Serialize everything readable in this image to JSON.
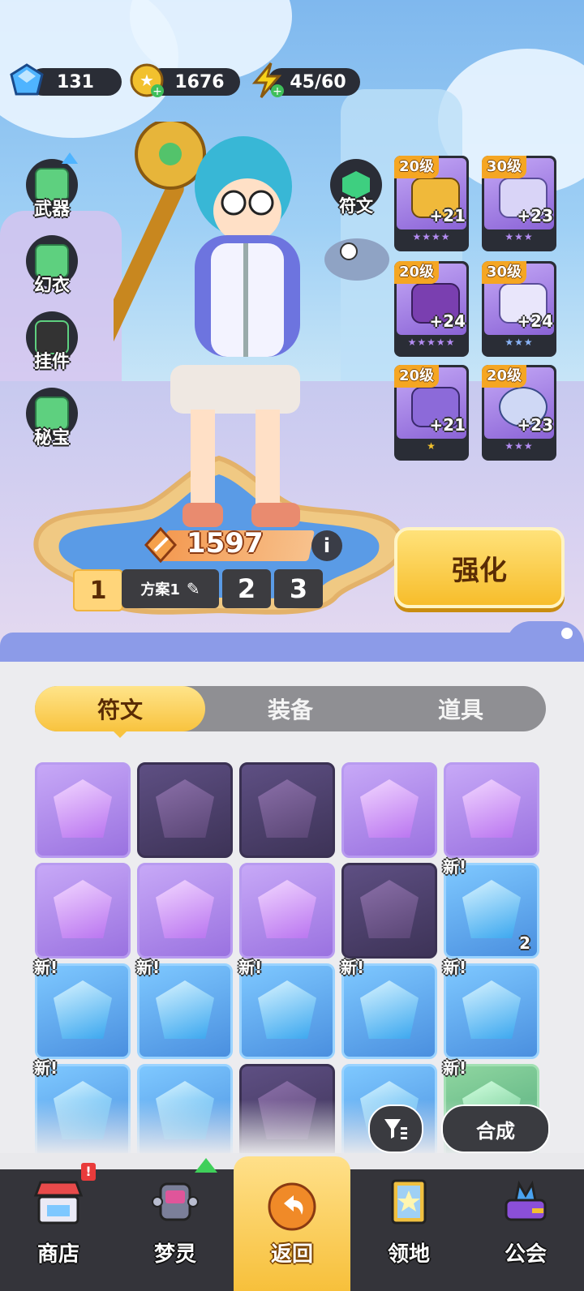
{
  "currencies": [
    {
      "name": "gem",
      "value": "131",
      "color": "#4fb4ff"
    },
    {
      "name": "gold",
      "value": "1676",
      "color": "#f2c12e"
    },
    {
      "name": "energy",
      "value": "45/60",
      "color": "#f7d21a"
    }
  ],
  "side_menu": [
    {
      "label": "武器",
      "icon": "weapon-icon"
    },
    {
      "label": "幻衣",
      "icon": "outfit-icon"
    },
    {
      "label": "挂件",
      "icon": "pendant-icon"
    },
    {
      "label": "秘宝",
      "icon": "treasure-icon"
    }
  ],
  "rune_button": {
    "label": "符文",
    "icon": "rune-icon"
  },
  "equipment": [
    {
      "level": "20级",
      "plus": "+21",
      "stars": "★★★★",
      "star_color": "#b48cf2"
    },
    {
      "level": "30级",
      "plus": "+23",
      "stars": "★★★",
      "star_color": "#b48cf2"
    },
    {
      "level": "20级",
      "plus": "+24",
      "stars": "★★★★★",
      "star_color": "#b48cf2"
    },
    {
      "level": "30级",
      "plus": "+24",
      "stars": "★★★",
      "star_color": "#8ab4f8"
    },
    {
      "level": "20级",
      "plus": "+21",
      "stars": "★",
      "star_color": "#f2c12e"
    },
    {
      "level": "20级",
      "plus": "+23",
      "stars": "★★★",
      "star_color": "#b48cf2"
    }
  ],
  "power": {
    "value": "1597",
    "info": "i"
  },
  "plans": {
    "current": "1",
    "name": "方案1",
    "others": [
      "2",
      "3"
    ]
  },
  "enhance_button": "强化",
  "tabs": [
    "符文",
    "装备",
    "道具"
  ],
  "active_tab": "符文",
  "grid_items": [
    {
      "rarity": "purple",
      "new": "",
      "count": ""
    },
    {
      "rarity": "dim",
      "new": "",
      "count": ""
    },
    {
      "rarity": "dim",
      "new": "",
      "count": ""
    },
    {
      "rarity": "purple",
      "new": "",
      "count": ""
    },
    {
      "rarity": "purple",
      "new": "",
      "count": ""
    },
    {
      "rarity": "purple",
      "new": "",
      "count": ""
    },
    {
      "rarity": "purple",
      "new": "",
      "count": ""
    },
    {
      "rarity": "purple",
      "new": "",
      "count": ""
    },
    {
      "rarity": "dim",
      "new": "",
      "count": ""
    },
    {
      "rarity": "blue",
      "new": "新!",
      "count": "2"
    },
    {
      "rarity": "blue",
      "new": "新!",
      "count": ""
    },
    {
      "rarity": "blue",
      "new": "新!",
      "count": ""
    },
    {
      "rarity": "blue",
      "new": "新!",
      "count": ""
    },
    {
      "rarity": "blue",
      "new": "新!",
      "count": ""
    },
    {
      "rarity": "blue",
      "new": "新!",
      "count": ""
    },
    {
      "rarity": "blue",
      "new": "新!",
      "count": ""
    },
    {
      "rarity": "blue",
      "new": "",
      "count": ""
    },
    {
      "rarity": "dim",
      "new": "",
      "count": ""
    },
    {
      "rarity": "blue",
      "new": "",
      "count": ""
    },
    {
      "rarity": "green",
      "new": "新!",
      "count": ""
    }
  ],
  "filter_icon": "filter-icon",
  "combine_button": "合成",
  "bottom_nav": [
    {
      "label": "商店",
      "icon": "shop-icon",
      "badge": "!"
    },
    {
      "label": "梦灵",
      "icon": "dream-spirit-icon",
      "badge": ""
    },
    {
      "label": "返回",
      "icon": "return-icon",
      "badge": ""
    },
    {
      "label": "领地",
      "icon": "territory-icon",
      "badge": ""
    },
    {
      "label": "公会",
      "icon": "guild-icon",
      "badge": ""
    }
  ],
  "colors": {
    "accent": "#f7bd2b",
    "panel": "#ececef",
    "nav": "#34343a"
  }
}
